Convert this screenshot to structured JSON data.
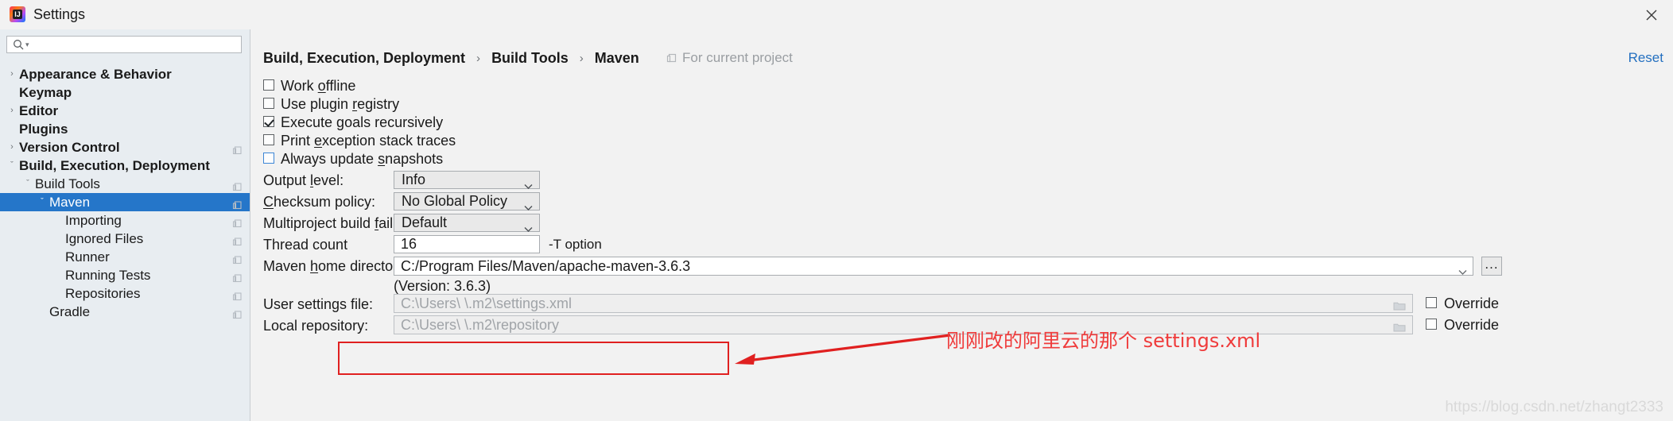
{
  "window": {
    "title": "Settings",
    "app_icon": "intellij-idea-icon",
    "close_label": "✕"
  },
  "sidebar": {
    "search": {
      "value": "",
      "placeholder": "",
      "icon": "search-icon"
    },
    "items": [
      {
        "label": "Appearance & Behavior",
        "arrow": "›",
        "indent": 24,
        "bold": true,
        "selected": false,
        "project_icon": false
      },
      {
        "label": "Keymap",
        "arrow": "",
        "indent": 24,
        "bold": true,
        "selected": false,
        "project_icon": false
      },
      {
        "label": "Editor",
        "arrow": "›",
        "indent": 24,
        "bold": true,
        "selected": false,
        "project_icon": false
      },
      {
        "label": "Plugins",
        "arrow": "",
        "indent": 24,
        "bold": true,
        "selected": false,
        "project_icon": false
      },
      {
        "label": "Version Control",
        "arrow": "›",
        "indent": 24,
        "bold": true,
        "selected": false,
        "project_icon": true
      },
      {
        "label": "Build, Execution, Deployment",
        "arrow": "ˇ",
        "indent": 24,
        "bold": true,
        "selected": false,
        "project_icon": false
      },
      {
        "label": "Build Tools",
        "arrow": "ˇ",
        "indent": 44,
        "bold": false,
        "selected": false,
        "project_icon": true
      },
      {
        "label": "Maven",
        "arrow": "ˇ",
        "indent": 62,
        "bold": false,
        "selected": true,
        "project_icon": true
      },
      {
        "label": "Importing",
        "arrow": "",
        "indent": 82,
        "bold": false,
        "selected": false,
        "project_icon": true
      },
      {
        "label": "Ignored Files",
        "arrow": "",
        "indent": 82,
        "bold": false,
        "selected": false,
        "project_icon": true
      },
      {
        "label": "Runner",
        "arrow": "",
        "indent": 82,
        "bold": false,
        "selected": false,
        "project_icon": true
      },
      {
        "label": "Running Tests",
        "arrow": "",
        "indent": 82,
        "bold": false,
        "selected": false,
        "project_icon": true
      },
      {
        "label": "Repositories",
        "arrow": "",
        "indent": 82,
        "bold": false,
        "selected": false,
        "project_icon": true
      },
      {
        "label": "Gradle",
        "arrow": "",
        "indent": 62,
        "bold": false,
        "selected": false,
        "project_icon": true
      }
    ]
  },
  "header": {
    "breadcrumb": [
      "Build, Execution, Deployment",
      "Build Tools",
      "Maven"
    ],
    "separator": "›",
    "scope_label": "For current project",
    "scope_icon": "project-scope-icon",
    "reset_label": "Reset"
  },
  "form": {
    "checkboxes": [
      {
        "label_before": "Work ",
        "mnemonic": "o",
        "label_after": "ffline",
        "checked": false,
        "focused": false
      },
      {
        "label_before": "Use plugin ",
        "mnemonic": "r",
        "label_after": "egistry",
        "checked": false,
        "focused": false
      },
      {
        "label_before": "Execute ",
        "mnemonic": "g",
        "label_after": "oals recursively",
        "checked": true,
        "focused": false
      },
      {
        "label_before": "Print ",
        "mnemonic": "e",
        "label_after": "xception stack traces",
        "checked": false,
        "focused": false
      },
      {
        "label_before": "Always update ",
        "mnemonic": "s",
        "label_after": "napshots",
        "checked": false,
        "focused": true
      }
    ],
    "output_level": {
      "label_before": "Output ",
      "mnemonic": "l",
      "label_after": "evel:",
      "value": "Info"
    },
    "checksum_policy": {
      "label_before": "",
      "mnemonic": "C",
      "label_after": "hecksum policy:",
      "value": "No Global Policy"
    },
    "multiproject_policy": {
      "label_before": "Multiproject build ",
      "mnemonic": "f",
      "label_after": "ail policy:",
      "value": "Default"
    },
    "thread_count": {
      "label": "Thread count",
      "value": "16",
      "hint": "-T option"
    },
    "maven_home": {
      "label_before": "Maven ",
      "mnemonic": "h",
      "label_after": "ome directory:",
      "value": "C:/Program Files/Maven/apache-maven-3.6.3",
      "browse_label": "...",
      "version_line": "(Version: 3.6.3)"
    },
    "user_settings_file": {
      "label": "User settings file:",
      "value": "C:\\Users\\          \\.m2\\settings.xml",
      "override_label": "Override",
      "override_checked": false,
      "folder_icon": "folder-icon"
    },
    "local_repository": {
      "label": "Local repository:",
      "value": "C:\\Users\\          \\.m2\\repository",
      "override_label": "Override",
      "override_checked": false,
      "folder_icon": "folder-icon"
    }
  },
  "annotation": {
    "text": "刚刚改的阿里云的那个 settings.xml",
    "color": "#ef3b3b"
  },
  "watermark": {
    "text": "https://blog.csdn.net/zhangt2333"
  },
  "colors": {
    "selection": "#2576c9",
    "sidebar_bg": "#e8edf1",
    "panel_bg": "#f2f2f2",
    "link": "#2470c0",
    "annotation": "#e02020"
  }
}
